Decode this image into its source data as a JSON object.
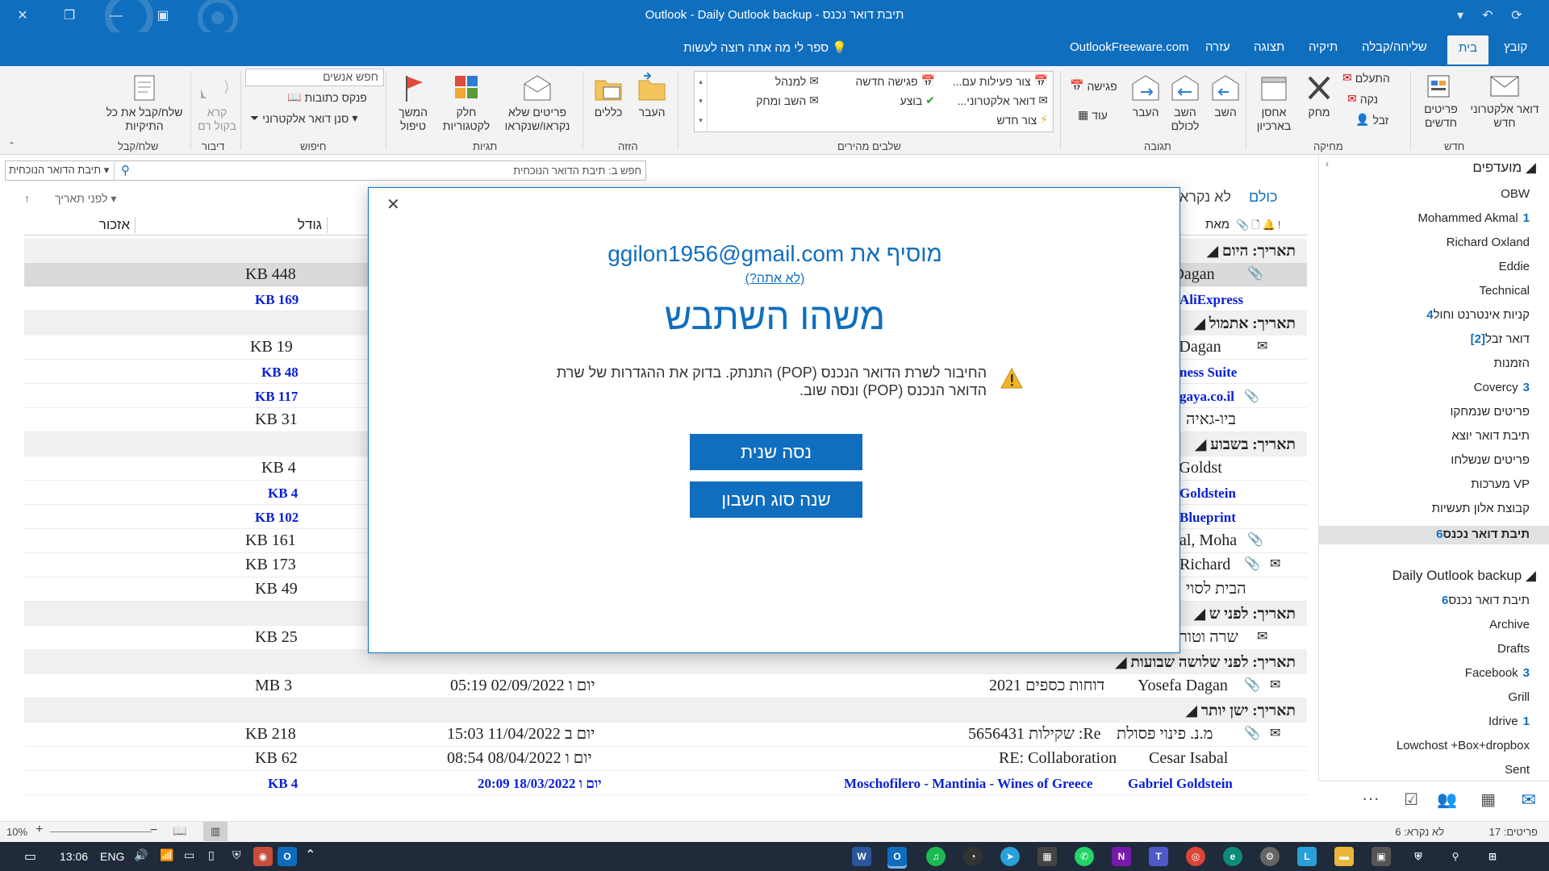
{
  "window": {
    "title": "Outlook - Daily Outlook backup - תיבת דואר נכנס"
  },
  "tabs": [
    "קובץ",
    "בית",
    "שליחה/קבלה",
    "תיקיה",
    "תצוגה",
    "עזרה",
    "OutlookFreeware.com"
  ],
  "tell_me": "ספר לי מה אתה רוצה לעשות",
  "ribbon": {
    "new_email": "דואר אלקטרוני חדש",
    "new_items": "פריטים חדשים",
    "group_new": "חדש",
    "ignore": "התעלם",
    "clean_up": "נקה",
    "junk": "זבל",
    "delete": "מחק",
    "archive": "אחסן בארכיון",
    "group_delete": "מחיקה",
    "reply": "השב",
    "reply_all": "השב לכולם",
    "forward": "העבר",
    "meeting": "פגישה",
    "more": "עוד",
    "group_respond": "תגובה",
    "qs_1": "צור פעילות עם...",
    "qs_2": "דואר אלקטרוני...",
    "qs_3": "צור חדש",
    "qs_4": "פגישה חדשה",
    "qs_5": "בוצע",
    "qs_6": "למנהל",
    "qs_7": "השב ומחק",
    "group_quick_steps": "שלבים מהירים",
    "move": "העבר",
    "rules": "כללים",
    "group_move": "הזזה",
    "unread_read": "פריטים שלא נקראו/שנקראו",
    "categorize": "חלק לקטגוריות",
    "follow_up": "המשך טיפול",
    "group_tags": "תגיות",
    "search_people": "חפש אנשים",
    "address_book": "פנקס כתובות",
    "filter_email": "סנן דואר אלקטרוני",
    "group_find": "חיפוש",
    "read_aloud": "קרא בקול רם",
    "group_speech": "דיבור",
    "send_receive_all": "שלח/קבל את כל התיקיות",
    "group_send_receive": "שלח/קבל"
  },
  "search": {
    "placeholder": "חפש ב: תיבת הדואר הנוכחית",
    "scope": "תיבת הדואר הנוכחית"
  },
  "list_header": {
    "all": "כולם",
    "unread": "לא נקרא",
    "by_date": "לפני תאריך",
    "col_from": "מאת",
    "col_size": "גודל",
    "col_category": "אזכור"
  },
  "groups": {
    "today": "תאריך: היום",
    "yesterday": "תאריך: אתמול",
    "this_week": "תאריך: בשבוע",
    "earlier": "תאריך: לפני ש",
    "three_weeks": "תאריך: לפני שלושה שבועות",
    "older": "תאריך: ישן יותר"
  },
  "rows": [
    {
      "from": "el Dagan",
      "size": "KB 448"
    },
    {
      "from": "AliExpress",
      "size": "KB 169"
    },
    {
      "from": "el Dagan",
      "size": "KB 19"
    },
    {
      "from": "ness Suite",
      "size": "KB 48"
    },
    {
      "from": "gaya.co.il",
      "size": "KB 117"
    },
    {
      "from": "ביו-גאיה",
      "size": "KB 31"
    },
    {
      "from": "el Goldst",
      "size": "KB 4"
    },
    {
      "from": "Goldstein",
      "size": "KB 4"
    },
    {
      "from": "Blueprint",
      "size": "KB 102"
    },
    {
      "from": "al, Moha",
      "size": "KB 161"
    },
    {
      "from": "Richard",
      "size": "KB 173"
    },
    {
      "from": "הבית לסוי",
      "size": "KB 49"
    },
    {
      "from": "שרה וטור",
      "size": "KB 25"
    },
    {
      "from": "Yosefa Dagan",
      "subject": "דוחות כספים 2021",
      "date": "יום ו 02/09/2022 05:19",
      "size": "MB 3"
    },
    {
      "from": "מ.נ. פינוי פסולת",
      "subject": "Re: שקילות 5656431",
      "date": "יום ב 11/04/2022 15:03",
      "size": "KB 218"
    },
    {
      "from": "Cesar Isabal",
      "subject": "RE: Collaboration",
      "date": "יום ו 08/04/2022 08:54",
      "size": "KB 62"
    },
    {
      "from": "Gabriel Goldstein",
      "subject": "Moschofilero - Mantinia - Wines of Greece",
      "date": "יום ו 18/03/2022 20:09",
      "size": "KB 4"
    }
  ],
  "folders": {
    "favorites": "מועדפים",
    "fav_items": [
      {
        "name": "OBW",
        "count": ""
      },
      {
        "name": "Mohammed Akmal",
        "count": "1"
      },
      {
        "name": "Richard Oxland",
        "count": ""
      },
      {
        "name": "Eddie",
        "count": ""
      },
      {
        "name": "Technical",
        "count": ""
      },
      {
        "name": "קניות אינטרנט וחול",
        "count": "4"
      },
      {
        "name": "דואר זבל",
        "count": "[2]"
      },
      {
        "name": "הזמנות",
        "count": ""
      },
      {
        "name": "Covercy",
        "count": "3"
      },
      {
        "name": "פריטים שנמחקו",
        "count": ""
      },
      {
        "name": "תיבת דואר יוצא",
        "count": ""
      },
      {
        "name": "פריטים שנשלחו",
        "count": ""
      },
      {
        "name": "VP מערכות",
        "count": ""
      },
      {
        "name": "קבוצת אלון תעשיות",
        "count": ""
      },
      {
        "name": "תיבת דואר נכנס",
        "count": "6"
      }
    ],
    "account": "Daily Outlook backup",
    "acc_items": [
      {
        "name": "תיבת דואר נכנס",
        "count": "6"
      },
      {
        "name": "Archive",
        "count": ""
      },
      {
        "name": "Drafts",
        "count": ""
      },
      {
        "name": "Facebook",
        "count": "3"
      },
      {
        "name": "Grill",
        "count": ""
      },
      {
        "name": "Idrive",
        "count": "1"
      },
      {
        "name": "Lowchost +Box+dropbox",
        "count": ""
      },
      {
        "name": "Sent",
        "count": ""
      }
    ]
  },
  "dialog": {
    "adding_prefix": "מוסיף את",
    "email": "ggilon1956@gmail.com",
    "not_you": "(לא אתה?)",
    "heading": "משהו השתבש",
    "message": "החיבור לשרת הדואר הנכנס (POP) התנתק. בדוק את ההגדרות של שרת הדואר הנכנס (POP) ונסה שוב.",
    "retry": "נסה שנית",
    "change_type": "שנה סוג חשבון"
  },
  "status": {
    "items": "פריטים: 17",
    "unread": "לא נקרא: 6",
    "zoom": "10%"
  },
  "taskbar": {
    "time": "13:06",
    "lang": "ENG"
  },
  "colors": {
    "accent": "#106ebe",
    "unread": "#0a21d6"
  }
}
